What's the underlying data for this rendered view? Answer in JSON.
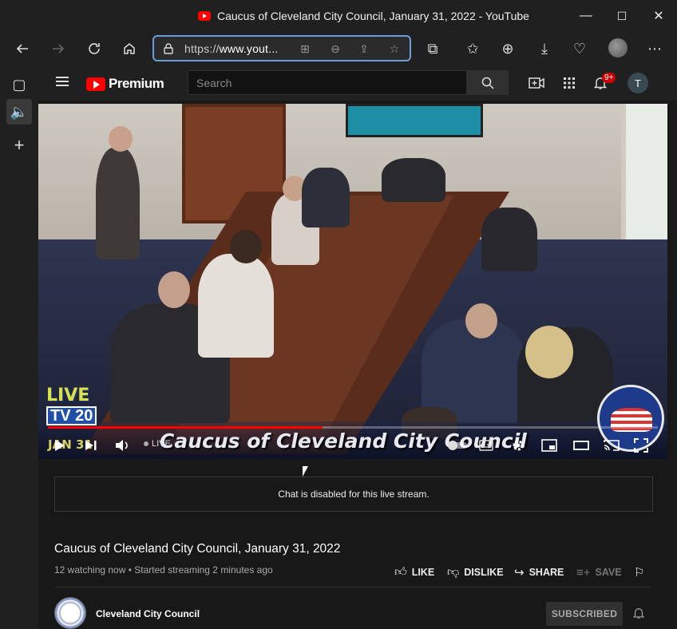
{
  "browser": {
    "tab_title": "Caucus of Cleveland City Council, January 31, 2022 - YouTube",
    "address_prefix": "https://",
    "address_host": "www.yout...",
    "window_controls": {
      "minimize": "—",
      "maximize": "☐",
      "close": "✕"
    }
  },
  "youtube": {
    "logo_text": "Premium",
    "search": {
      "placeholder": "Search",
      "value": ""
    },
    "notifications_badge": "9+",
    "user_initial": "T"
  },
  "player": {
    "overlay_logo_top": "LIVE",
    "overlay_logo_bottom": "TV 20",
    "date_caption": "JAN 31",
    "caption": "Caucus of Cleveland City Council",
    "live_label": "LIVE",
    "progress": 0.45
  },
  "chat": {
    "disabled_message": "Chat is disabled for this live stream."
  },
  "video": {
    "title": "Caucus of Cleveland City Council, January 31, 2022",
    "meta": "12 watching now • Started streaming 2 minutes ago",
    "like_label": "LIKE",
    "dislike_label": "DISLIKE",
    "share_label": "SHARE",
    "save_label": "SAVE"
  },
  "channel": {
    "name": "Cleveland City Council",
    "subscribe_label": "SUBSCRIBED"
  },
  "colors": {
    "accent": "#ff0000",
    "url_focus": "#6b9ed8",
    "background": "#181818"
  }
}
